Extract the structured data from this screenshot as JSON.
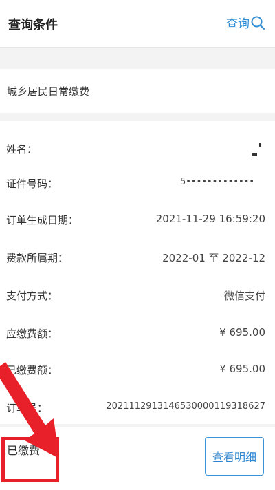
{
  "header": {
    "title": "查询条件",
    "search_label": "查询",
    "search_icon": "search-icon"
  },
  "category": {
    "label": "城乡居民日常缴费"
  },
  "details": {
    "rows": [
      {
        "label": "姓名：",
        "value": ""
      },
      {
        "label": "证件号码：",
        "value": "5•••••••••••••"
      },
      {
        "label": "订单生成日期：",
        "value": "2021-11-29 16:59:20"
      },
      {
        "label": "费款所属期：",
        "value": "2022-01 至 2022-12"
      },
      {
        "label": "支付方式：",
        "value": "微信支付"
      },
      {
        "label": "应缴费额：",
        "value": "¥ 695.00"
      },
      {
        "label": "已缴费额：",
        "value": "¥ 695.00"
      },
      {
        "label": "订单号：",
        "value": "20211129131465300001193186​27"
      }
    ]
  },
  "footer": {
    "status": "已缴费",
    "detail_button": "查看明细"
  },
  "colors": {
    "accent": "#2f8fd8",
    "highlight": "#e8202a"
  }
}
